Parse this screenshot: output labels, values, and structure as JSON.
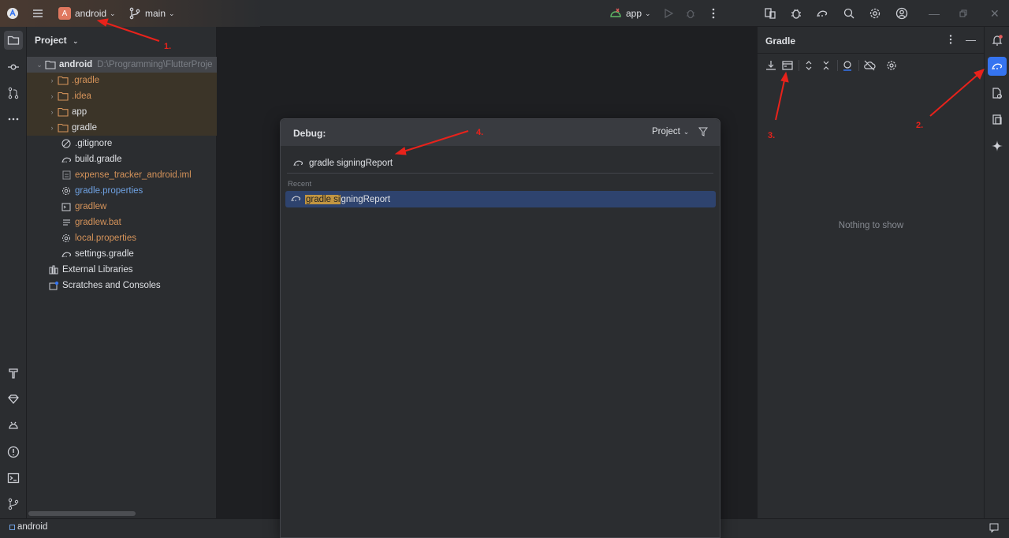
{
  "titlebar": {
    "project_initial": "A",
    "project_name": "android",
    "branch": "main",
    "run_config": "app"
  },
  "project_panel": {
    "title": "Project",
    "tree": [
      {
        "name": "android",
        "path": "D:\\Programming\\FlutterProje",
        "type": "folder-root"
      },
      {
        "name": ".gradle",
        "type": "folder",
        "color": "orange"
      },
      {
        "name": ".idea",
        "type": "folder",
        "color": "orange"
      },
      {
        "name": "app",
        "type": "folder"
      },
      {
        "name": "gradle",
        "type": "folder"
      },
      {
        "name": ".gitignore",
        "type": "file-ignore"
      },
      {
        "name": "build.gradle",
        "type": "file-gradle"
      },
      {
        "name": "expense_tracker_android.iml",
        "type": "file-iml",
        "color": "orange"
      },
      {
        "name": "gradle.properties",
        "type": "file-props",
        "color": "blue"
      },
      {
        "name": "gradlew",
        "type": "file-term",
        "color": "orange"
      },
      {
        "name": "gradlew.bat",
        "type": "file-bat",
        "color": "orange"
      },
      {
        "name": "local.properties",
        "type": "file-props",
        "color": "orange"
      },
      {
        "name": "settings.gradle",
        "type": "file-gradle"
      },
      {
        "name": "External Libraries",
        "type": "libs"
      },
      {
        "name": "Scratches and Consoles",
        "type": "scratch"
      }
    ]
  },
  "popup": {
    "title": "Debug:",
    "scope": "Project",
    "command": "gradle signingReport",
    "recent_label": "Recent",
    "recent_item_match": "gradle si",
    "recent_item_rest": "gningReport"
  },
  "gradle_panel": {
    "title": "Gradle",
    "empty_text": "Nothing to show"
  },
  "statusbar": {
    "project": "android"
  },
  "annotations": {
    "one": "1.",
    "two": "2.",
    "three": "3.",
    "four": "4."
  },
  "colors": {
    "accent": "#3574f0",
    "annotation": "#e8221b",
    "selection": "#2e436e",
    "match_highlight": "#c29642"
  }
}
